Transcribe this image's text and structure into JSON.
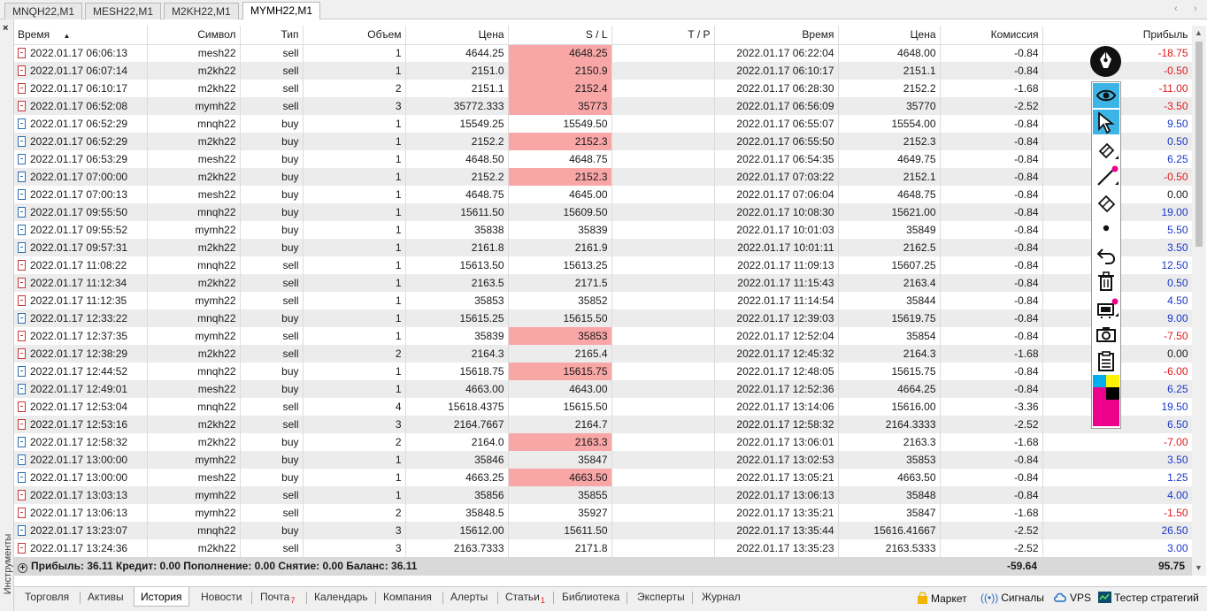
{
  "chart_tabs": [
    {
      "label": "MNQH22,M1",
      "active": false
    },
    {
      "label": "MESH22,M1",
      "active": false
    },
    {
      "label": "M2KH22,M1",
      "active": false
    },
    {
      "label": "MYMH22,M1",
      "active": true
    }
  ],
  "chart_tab_nav": {
    "prev": "‹",
    "next": "›"
  },
  "panel": {
    "close": "×",
    "side_label": "Инструменты"
  },
  "columns": {
    "time_open": "Время",
    "symbol": "Символ",
    "type": "Тип",
    "volume": "Объем",
    "price_open": "Цена",
    "sl": "S / L",
    "tp": "T / P",
    "time_close": "Время",
    "price_close": "Цена",
    "commission": "Комиссия",
    "profit": "Прибыль"
  },
  "sort_indicator": "▲",
  "rows": [
    {
      "time_open": "2022.01.17 06:06:13",
      "symbol": "mesh22",
      "type": "sell",
      "volume": "1",
      "price_open": "4644.25",
      "sl": "4648.25",
      "sl_hit": true,
      "tp": "",
      "time_close": "2022.01.17 06:22:04",
      "price_close": "4648.00",
      "commission": "-0.84",
      "profit": "-18.75"
    },
    {
      "time_open": "2022.01.17 06:07:14",
      "symbol": "m2kh22",
      "type": "sell",
      "volume": "1",
      "price_open": "2151.0",
      "sl": "2150.9",
      "sl_hit": true,
      "tp": "",
      "time_close": "2022.01.17 06:10:17",
      "price_close": "2151.1",
      "commission": "-0.84",
      "profit": "-0.50"
    },
    {
      "time_open": "2022.01.17 06:10:17",
      "symbol": "m2kh22",
      "type": "sell",
      "volume": "2",
      "price_open": "2151.1",
      "sl": "2152.4",
      "sl_hit": true,
      "tp": "",
      "time_close": "2022.01.17 06:28:30",
      "price_close": "2152.2",
      "commission": "-1.68",
      "profit": "-11.00"
    },
    {
      "time_open": "2022.01.17 06:52:08",
      "symbol": "mymh22",
      "type": "sell",
      "volume": "3",
      "price_open": "35772.333",
      "sl": "35773",
      "sl_hit": true,
      "tp": "",
      "time_close": "2022.01.17 06:56:09",
      "price_close": "35770",
      "commission": "-2.52",
      "profit": "-3.50"
    },
    {
      "time_open": "2022.01.17 06:52:29",
      "symbol": "mnqh22",
      "type": "buy",
      "volume": "1",
      "price_open": "15549.25",
      "sl": "15549.50",
      "sl_hit": false,
      "tp": "",
      "time_close": "2022.01.17 06:55:07",
      "price_close": "15554.00",
      "commission": "-0.84",
      "profit": "9.50"
    },
    {
      "time_open": "2022.01.17 06:52:29",
      "symbol": "m2kh22",
      "type": "buy",
      "volume": "1",
      "price_open": "2152.2",
      "sl": "2152.3",
      "sl_hit": true,
      "tp": "",
      "time_close": "2022.01.17 06:55:50",
      "price_close": "2152.3",
      "commission": "-0.84",
      "profit": "0.50"
    },
    {
      "time_open": "2022.01.17 06:53:29",
      "symbol": "mesh22",
      "type": "buy",
      "volume": "1",
      "price_open": "4648.50",
      "sl": "4648.75",
      "sl_hit": false,
      "tp": "",
      "time_close": "2022.01.17 06:54:35",
      "price_close": "4649.75",
      "commission": "-0.84",
      "profit": "6.25"
    },
    {
      "time_open": "2022.01.17 07:00:00",
      "symbol": "m2kh22",
      "type": "buy",
      "volume": "1",
      "price_open": "2152.2",
      "sl": "2152.3",
      "sl_hit": true,
      "tp": "",
      "time_close": "2022.01.17 07:03:22",
      "price_close": "2152.1",
      "commission": "-0.84",
      "profit": "-0.50"
    },
    {
      "time_open": "2022.01.17 07:00:13",
      "symbol": "mesh22",
      "type": "buy",
      "volume": "1",
      "price_open": "4648.75",
      "sl": "4645.00",
      "sl_hit": false,
      "tp": "",
      "time_close": "2022.01.17 07:06:04",
      "price_close": "4648.75",
      "commission": "-0.84",
      "profit": "0.00"
    },
    {
      "time_open": "2022.01.17 09:55:50",
      "symbol": "mnqh22",
      "type": "buy",
      "volume": "1",
      "price_open": "15611.50",
      "sl": "15609.50",
      "sl_hit": false,
      "tp": "",
      "time_close": "2022.01.17 10:08:30",
      "price_close": "15621.00",
      "commission": "-0.84",
      "profit": "19.00"
    },
    {
      "time_open": "2022.01.17 09:55:52",
      "symbol": "mymh22",
      "type": "buy",
      "volume": "1",
      "price_open": "35838",
      "sl": "35839",
      "sl_hit": false,
      "tp": "",
      "time_close": "2022.01.17 10:01:03",
      "price_close": "35849",
      "commission": "-0.84",
      "profit": "5.50"
    },
    {
      "time_open": "2022.01.17 09:57:31",
      "symbol": "m2kh22",
      "type": "buy",
      "volume": "1",
      "price_open": "2161.8",
      "sl": "2161.9",
      "sl_hit": false,
      "tp": "",
      "time_close": "2022.01.17 10:01:11",
      "price_close": "2162.5",
      "commission": "-0.84",
      "profit": "3.50"
    },
    {
      "time_open": "2022.01.17 11:08:22",
      "symbol": "mnqh22",
      "type": "sell",
      "volume": "1",
      "price_open": "15613.50",
      "sl": "15613.25",
      "sl_hit": false,
      "tp": "",
      "time_close": "2022.01.17 11:09:13",
      "price_close": "15607.25",
      "commission": "-0.84",
      "profit": "12.50"
    },
    {
      "time_open": "2022.01.17 11:12:34",
      "symbol": "m2kh22",
      "type": "sell",
      "volume": "1",
      "price_open": "2163.5",
      "sl": "2171.5",
      "sl_hit": false,
      "tp": "",
      "time_close": "2022.01.17 11:15:43",
      "price_close": "2163.4",
      "commission": "-0.84",
      "profit": "0.50"
    },
    {
      "time_open": "2022.01.17 11:12:35",
      "symbol": "mymh22",
      "type": "sell",
      "volume": "1",
      "price_open": "35853",
      "sl": "35852",
      "sl_hit": false,
      "tp": "",
      "time_close": "2022.01.17 11:14:54",
      "price_close": "35844",
      "commission": "-0.84",
      "profit": "4.50"
    },
    {
      "time_open": "2022.01.17 12:33:22",
      "symbol": "mnqh22",
      "type": "buy",
      "volume": "1",
      "price_open": "15615.25",
      "sl": "15615.50",
      "sl_hit": false,
      "tp": "",
      "time_close": "2022.01.17 12:39:03",
      "price_close": "15619.75",
      "commission": "-0.84",
      "profit": "9.00"
    },
    {
      "time_open": "2022.01.17 12:37:35",
      "symbol": "mymh22",
      "type": "sell",
      "volume": "1",
      "price_open": "35839",
      "sl": "35853",
      "sl_hit": true,
      "tp": "",
      "time_close": "2022.01.17 12:52:04",
      "price_close": "35854",
      "commission": "-0.84",
      "profit": "-7.50"
    },
    {
      "time_open": "2022.01.17 12:38:29",
      "symbol": "m2kh22",
      "type": "sell",
      "volume": "2",
      "price_open": "2164.3",
      "sl": "2165.4",
      "sl_hit": false,
      "tp": "",
      "time_close": "2022.01.17 12:45:32",
      "price_close": "2164.3",
      "commission": "-1.68",
      "profit": "0.00"
    },
    {
      "time_open": "2022.01.17 12:44:52",
      "symbol": "mnqh22",
      "type": "buy",
      "volume": "1",
      "price_open": "15618.75",
      "sl": "15615.75",
      "sl_hit": true,
      "tp": "",
      "time_close": "2022.01.17 12:48:05",
      "price_close": "15615.75",
      "commission": "-0.84",
      "profit": "-6.00"
    },
    {
      "time_open": "2022.01.17 12:49:01",
      "symbol": "mesh22",
      "type": "buy",
      "volume": "1",
      "price_open": "4663.00",
      "sl": "4643.00",
      "sl_hit": false,
      "tp": "",
      "time_close": "2022.01.17 12:52:36",
      "price_close": "4664.25",
      "commission": "-0.84",
      "profit": "6.25"
    },
    {
      "time_open": "2022.01.17 12:53:04",
      "symbol": "mnqh22",
      "type": "sell",
      "volume": "4",
      "price_open": "15618.4375",
      "sl": "15615.50",
      "sl_hit": false,
      "tp": "",
      "time_close": "2022.01.17 13:14:06",
      "price_close": "15616.00",
      "commission": "-3.36",
      "profit": "19.50"
    },
    {
      "time_open": "2022.01.17 12:53:16",
      "symbol": "m2kh22",
      "type": "sell",
      "volume": "3",
      "price_open": "2164.7667",
      "sl": "2164.7",
      "sl_hit": false,
      "tp": "",
      "time_close": "2022.01.17 12:58:32",
      "price_close": "2164.3333",
      "commission": "-2.52",
      "profit": "6.50"
    },
    {
      "time_open": "2022.01.17 12:58:32",
      "symbol": "m2kh22",
      "type": "buy",
      "volume": "2",
      "price_open": "2164.0",
      "sl": "2163.3",
      "sl_hit": true,
      "tp": "",
      "time_close": "2022.01.17 13:06:01",
      "price_close": "2163.3",
      "commission": "-1.68",
      "profit": "-7.00"
    },
    {
      "time_open": "2022.01.17 13:00:00",
      "symbol": "mymh22",
      "type": "buy",
      "volume": "1",
      "price_open": "35846",
      "sl": "35847",
      "sl_hit": false,
      "tp": "",
      "time_close": "2022.01.17 13:02:53",
      "price_close": "35853",
      "commission": "-0.84",
      "profit": "3.50"
    },
    {
      "time_open": "2022.01.17 13:00:00",
      "symbol": "mesh22",
      "type": "buy",
      "volume": "1",
      "price_open": "4663.25",
      "sl": "4663.50",
      "sl_hit": true,
      "tp": "",
      "time_close": "2022.01.17 13:05:21",
      "price_close": "4663.50",
      "commission": "-0.84",
      "profit": "1.25"
    },
    {
      "time_open": "2022.01.17 13:03:13",
      "symbol": "mymh22",
      "type": "sell",
      "volume": "1",
      "price_open": "35856",
      "sl": "35855",
      "sl_hit": false,
      "tp": "",
      "time_close": "2022.01.17 13:06:13",
      "price_close": "35848",
      "commission": "-0.84",
      "profit": "4.00"
    },
    {
      "time_open": "2022.01.17 13:06:13",
      "symbol": "mymh22",
      "type": "sell",
      "volume": "2",
      "price_open": "35848.5",
      "sl": "35927",
      "sl_hit": false,
      "tp": "",
      "time_close": "2022.01.17 13:35:21",
      "price_close": "35847",
      "commission": "-1.68",
      "profit": "-1.50"
    },
    {
      "time_open": "2022.01.17 13:23:07",
      "symbol": "mnqh22",
      "type": "buy",
      "volume": "3",
      "price_open": "15612.00",
      "sl": "15611.50",
      "sl_hit": false,
      "tp": "",
      "time_close": "2022.01.17 13:35:44",
      "price_close": "15616.41667",
      "commission": "-2.52",
      "profit": "26.50"
    },
    {
      "time_open": "2022.01.17 13:24:36",
      "symbol": "m2kh22",
      "type": "sell",
      "volume": "3",
      "price_open": "2163.7333",
      "sl": "2171.8",
      "sl_hit": false,
      "tp": "",
      "time_close": "2022.01.17 13:35:23",
      "price_close": "2163.5333",
      "commission": "-2.52",
      "profit": "3.00"
    }
  ],
  "summary": {
    "text": "Прибыль: 36.11  Кредит: 0.00  Пополнение: 0.00  Снятие: 0.00  Баланс: 36.11",
    "commission_total": "-59.64",
    "profit_total": "95.75"
  },
  "drawing_toolbar": {
    "tools": [
      "eye-icon",
      "cursor-icon",
      "highlighter-icon",
      "pen-icon",
      "eraser-icon",
      "dot-icon",
      "undo-icon",
      "trash-icon",
      "screen-icon",
      "camera-icon",
      "clipboard-icon",
      "palette-icon"
    ],
    "active_tools": [
      "eye-icon",
      "cursor-icon"
    ],
    "palette_colors": [
      "#00aeef",
      "#fff200",
      "#ec008c",
      "#000000"
    ]
  },
  "bottom_tabs": [
    {
      "label": "Торговля",
      "badge": ""
    },
    {
      "label": "Активы",
      "badge": ""
    },
    {
      "label": "История",
      "badge": "",
      "active": true
    },
    {
      "label": "Новости",
      "badge": ""
    },
    {
      "label": "Почта",
      "badge": "7"
    },
    {
      "label": "Календарь",
      "badge": ""
    },
    {
      "label": "Компания",
      "badge": ""
    },
    {
      "label": "Алерты",
      "badge": ""
    },
    {
      "label": "Статьи",
      "badge": "1"
    },
    {
      "label": "Библиотека",
      "badge": ""
    },
    {
      "label": "Эксперты",
      "badge": ""
    },
    {
      "label": "Журнал",
      "badge": ""
    }
  ],
  "right_links": [
    {
      "label": "Маркет",
      "icon": "bag-icon"
    },
    {
      "label": "Сигналы",
      "icon": "signal-icon"
    },
    {
      "label": "VPS",
      "icon": "cloud-icon"
    },
    {
      "label": "Тестер стратегий",
      "icon": "tester-icon"
    }
  ],
  "colors": {
    "loss": "#e0191c",
    "gain": "#1a37c9",
    "sl_hit_bg": "#f9a6a6",
    "toolbar_active": "#3cb4e5"
  }
}
